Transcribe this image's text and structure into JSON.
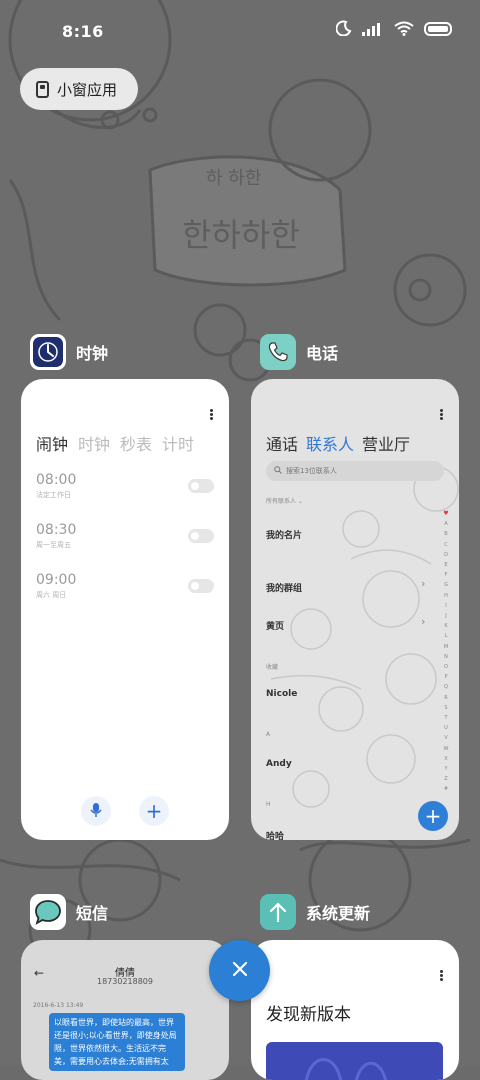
{
  "status_bar": {
    "time": "8:16",
    "icons": [
      "moon-icon",
      "signal-icon",
      "wifi-icon",
      "battery-icon"
    ]
  },
  "floating_windows": {
    "label": "小窗应用",
    "icon": "floating-window-icon"
  },
  "apps": {
    "clock": {
      "name": "时钟",
      "icon": "clock-icon",
      "tabs": [
        "闹钟",
        "时钟",
        "秒表",
        "计时"
      ],
      "alarms": [
        {
          "time": "08:00",
          "repeat": "法定工作日"
        },
        {
          "time": "08:30",
          "repeat": "周一至周五"
        },
        {
          "time": "09:00",
          "repeat": "周六 周日"
        }
      ]
    },
    "phone": {
      "name": "电话",
      "icon": "phone-icon",
      "tabs": [
        "通话",
        "联系人",
        "营业厅"
      ],
      "search_placeholder": "搜索13位联系人",
      "all_contacts_label": "所有联系人",
      "rows": [
        "我的名片",
        "我的群组",
        "黄页"
      ],
      "favorites_label": "收藏",
      "contacts": [
        "Nicole",
        "Andy",
        "哈哈"
      ],
      "section_a": "A",
      "section_h": "H",
      "index_letters": [
        "A",
        "B",
        "C",
        "D",
        "E",
        "F",
        "G",
        "H",
        "I",
        "J",
        "K",
        "L",
        "M",
        "N",
        "O",
        "P",
        "Q",
        "R",
        "S",
        "T",
        "U",
        "V",
        "W",
        "X",
        "Y",
        "Z",
        "#"
      ]
    },
    "sms": {
      "name": "短信",
      "icon": "message-icon",
      "contact_name": "倩倩",
      "contact_number": "18730218809",
      "date": "2016-6-13 13:49",
      "message": "以眼看世界，即使站的最高，世界还是很小;以心看世界，即使身处局限，世界依然很大。生活远不完美，需要用心去体会;无需拥有太"
    },
    "update": {
      "name": "系统更新",
      "icon": "update-arrow-icon",
      "title": "发现新版本"
    }
  },
  "colors": {
    "accent": "#2b7fd4",
    "clock_icon_bg": "#1e2e6e",
    "phone_icon_bg": "#7dd0c5",
    "sms_icon_bg": "#6ac7bd",
    "update_icon_bg": "#5bbfb5"
  }
}
